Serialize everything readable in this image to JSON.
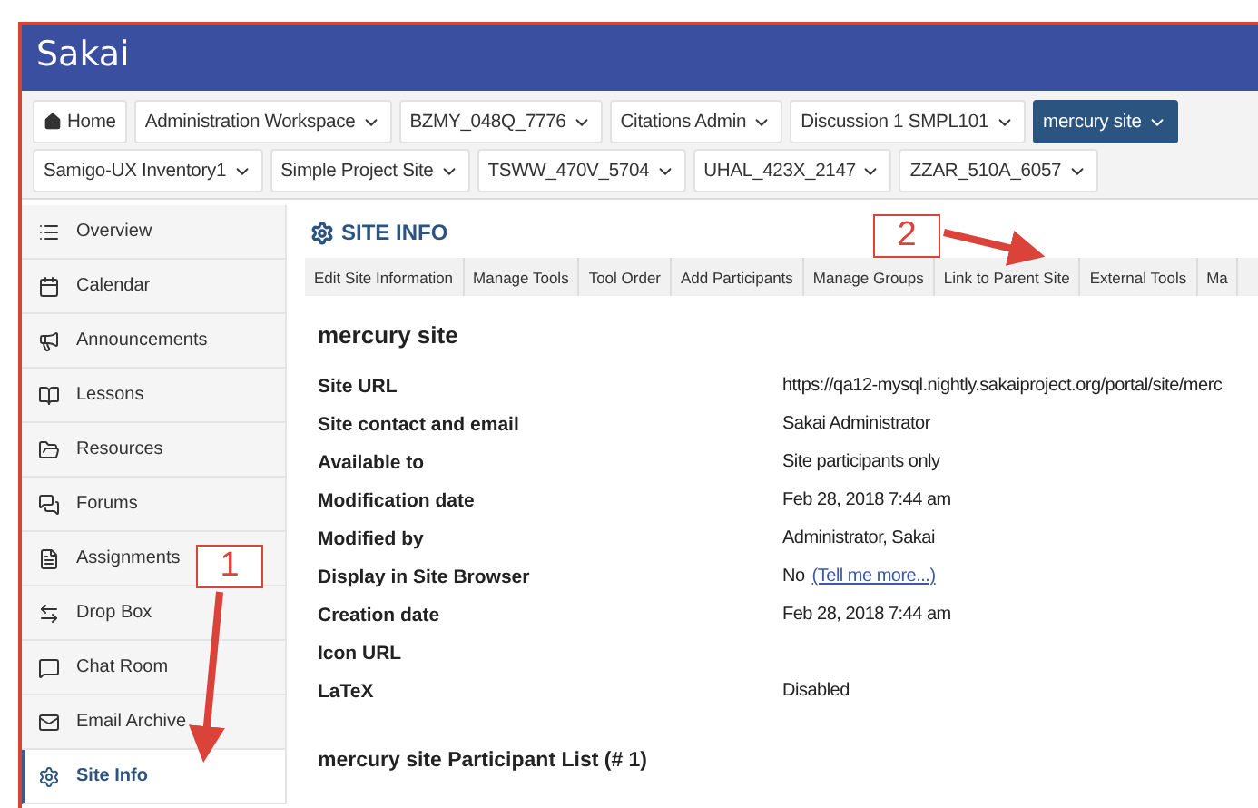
{
  "header": {
    "logo": "Sakai"
  },
  "site_tabs": [
    [
      {
        "label": "Home",
        "kind": "home",
        "selected": false
      },
      {
        "label": "Administration Workspace",
        "kind": "site",
        "selected": false
      },
      {
        "label": "BZMY_048Q_7776",
        "kind": "site",
        "selected": false
      },
      {
        "label": "Citations Admin",
        "kind": "site",
        "selected": false
      },
      {
        "label": "Discussion 1 SMPL101",
        "kind": "site",
        "selected": false
      },
      {
        "label": "mercury site",
        "kind": "site",
        "selected": true
      }
    ],
    [
      {
        "label": "Samigo-UX Inventory1",
        "kind": "site",
        "selected": false
      },
      {
        "label": "Simple Project Site",
        "kind": "site",
        "selected": false
      },
      {
        "label": "TSWW_470V_5704",
        "kind": "site",
        "selected": false
      },
      {
        "label": "UHAL_423X_2147",
        "kind": "site",
        "selected": false
      },
      {
        "label": "ZZAR_510A_6057",
        "kind": "site",
        "selected": false
      }
    ]
  ],
  "sidebar": {
    "items": [
      {
        "label": "Overview",
        "selected": false
      },
      {
        "label": "Calendar",
        "selected": false
      },
      {
        "label": "Announcements",
        "selected": false
      },
      {
        "label": "Lessons",
        "selected": false
      },
      {
        "label": "Resources",
        "selected": false
      },
      {
        "label": "Forums",
        "selected": false
      },
      {
        "label": "Assignments",
        "selected": false
      },
      {
        "label": "Drop Box",
        "selected": false
      },
      {
        "label": "Chat Room",
        "selected": false
      },
      {
        "label": "Email Archive",
        "selected": false
      },
      {
        "label": "Site Info",
        "selected": true
      }
    ]
  },
  "tool": {
    "title": "SITE INFO",
    "tabs": [
      "Edit Site Information",
      "Manage Tools",
      "Tool Order",
      "Add Participants",
      "Manage Groups",
      "Link to Parent Site",
      "External Tools",
      "Ma"
    ],
    "site_title": "mercury site",
    "rows": [
      {
        "label": "Site URL",
        "value": "https://qa12-mysql.nightly.sakaiproject.org/portal/site/merc"
      },
      {
        "label": "Site contact and email",
        "value": "Sakai Administrator"
      },
      {
        "label": "Available to",
        "value": "Site participants only"
      },
      {
        "label": "Modification date",
        "value": "Feb 28, 2018 7:44 am"
      },
      {
        "label": "Modified by",
        "value": "Administrator, Sakai"
      },
      {
        "label": "Display in Site Browser",
        "value": "No",
        "link": "(Tell me more...)"
      },
      {
        "label": "Creation date",
        "value": "Feb 28, 2018 7:44 am"
      },
      {
        "label": "Icon URL"
      },
      {
        "label": "LaTeX",
        "value": "Disabled"
      }
    ],
    "participants_heading": "mercury site Participant List (# 1)"
  },
  "annotations": [
    {
      "label": "1"
    },
    {
      "label": "2"
    }
  ]
}
